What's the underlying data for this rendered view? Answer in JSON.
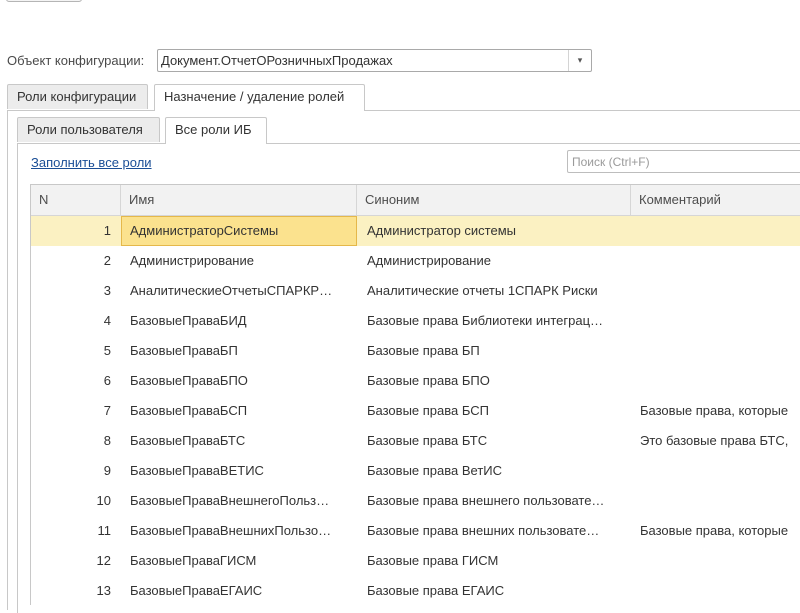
{
  "object_config": {
    "label": "Объект конфигурации:",
    "value": "Документ.ОтчетОРозничныхПродажах"
  },
  "outer_tabs": [
    {
      "label": "Роли конфигурации"
    },
    {
      "label": "Назначение / удаление ролей"
    }
  ],
  "inner_tabs": [
    {
      "label": "Роли пользователя"
    },
    {
      "label": "Все роли ИБ"
    }
  ],
  "fill_all_link": "Заполнить все роли",
  "search": {
    "placeholder": "Поиск (Ctrl+F)"
  },
  "grid": {
    "headers": {
      "n": "N",
      "name": "Имя",
      "synonym": "Синоним",
      "comment": "Комментарий"
    },
    "rows": [
      {
        "n": "1",
        "name": "АдминистраторСистемы",
        "synonym": "Администратор системы",
        "comment": ""
      },
      {
        "n": "2",
        "name": "Администрирование",
        "synonym": "Администрирование",
        "comment": ""
      },
      {
        "n": "3",
        "name": "АналитическиеОтчетыСПАРКР…",
        "synonym": "Аналитические отчеты 1СПАРК Риски",
        "comment": ""
      },
      {
        "n": "4",
        "name": "БазовыеПраваБИД",
        "synonym": "Базовые права Библиотеки интеграц…",
        "comment": ""
      },
      {
        "n": "5",
        "name": "БазовыеПраваБП",
        "synonym": "Базовые права БП",
        "comment": ""
      },
      {
        "n": "6",
        "name": "БазовыеПраваБПО",
        "synonym": "Базовые права БПО",
        "comment": ""
      },
      {
        "n": "7",
        "name": "БазовыеПраваБСП",
        "synonym": "Базовые права БСП",
        "comment": "Базовые права, которые"
      },
      {
        "n": "8",
        "name": "БазовыеПраваБТС",
        "synonym": "Базовые права БТС",
        "comment": "Это базовые права БТС,"
      },
      {
        "n": "9",
        "name": "БазовыеПраваВЕТИС",
        "synonym": "Базовые права ВетИС",
        "comment": ""
      },
      {
        "n": "10",
        "name": "БазовыеПраваВнешнегоПольз…",
        "synonym": "Базовые права внешнего пользовате…",
        "comment": ""
      },
      {
        "n": "11",
        "name": "БазовыеПраваВнешнихПользо…",
        "synonym": "Базовые права внешних пользовате…",
        "comment": "Базовые права, которые"
      },
      {
        "n": "12",
        "name": "БазовыеПраваГИСМ",
        "synonym": "Базовые права ГИСМ",
        "comment": ""
      },
      {
        "n": "13",
        "name": "БазовыеПраваЕГАИС",
        "synonym": "Базовые права ЕГАИС",
        "comment": ""
      }
    ]
  }
}
